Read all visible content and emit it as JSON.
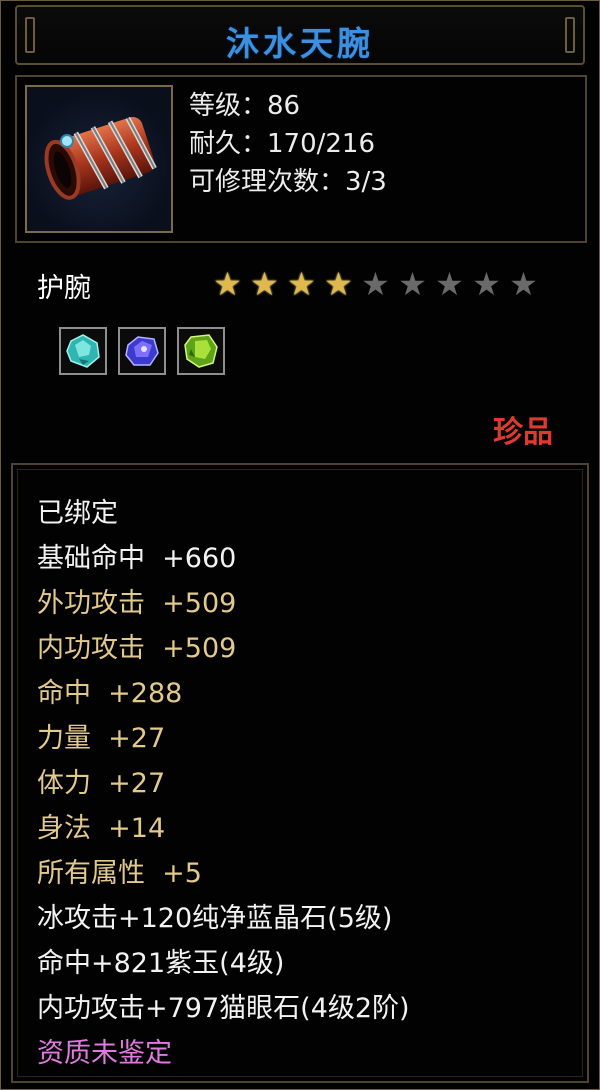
{
  "title": "沐水天腕",
  "stats": {
    "level": "等级：86",
    "durability": "耐久：170/216",
    "repair": "可修理次数：3/3"
  },
  "item_type": "护腕",
  "stars": {
    "filled": 4,
    "total": 9
  },
  "gems": [
    "cyan-gem-icon",
    "purple-gem-icon",
    "green-gem-icon"
  ],
  "rarity": "珍品",
  "attributes": [
    {
      "text": "已绑定",
      "color": "#f2f2f2"
    },
    {
      "text": "基础命中  +660",
      "color": "#f2f2f2"
    },
    {
      "text": "外功攻击  +509",
      "color": "#e2c98c"
    },
    {
      "text": "内功攻击  +509",
      "color": "#e2c98c"
    },
    {
      "text": "命中  +288",
      "color": "#e2c98c"
    },
    {
      "text": "力量  +27",
      "color": "#e2c98c"
    },
    {
      "text": "体力  +27",
      "color": "#e2c98c"
    },
    {
      "text": "身法  +14",
      "color": "#e2c98c"
    },
    {
      "text": "所有属性  +5",
      "color": "#e2c98c"
    },
    {
      "text": "冰攻击+120纯净蓝晶石(5级)",
      "color": "#f2f2f2"
    },
    {
      "text": "命中+821紫玉(4级)",
      "color": "#f2f2f2"
    },
    {
      "text": "内功攻击+797猫眼石(4级2阶)",
      "color": "#f2f2f2"
    },
    {
      "text": "资质未鉴定",
      "color": "#e07ae0"
    }
  ]
}
